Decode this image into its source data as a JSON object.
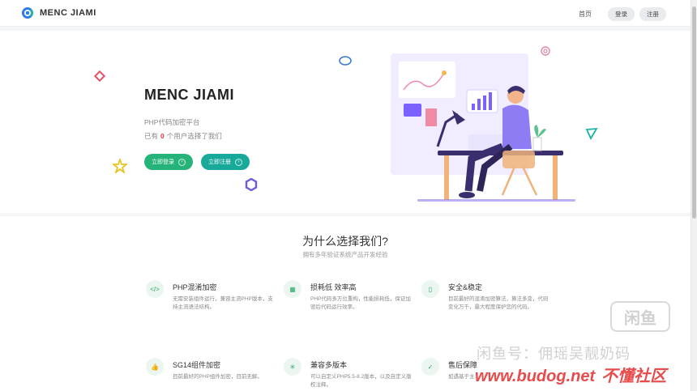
{
  "header": {
    "brand": "MENC JIAMI",
    "nav": {
      "home": "首页",
      "login": "登录",
      "register": "注册"
    }
  },
  "hero": {
    "title": "MENC JIAMI",
    "subtitle": "PHP代码加密平台",
    "count_prefix": "已有",
    "count_value": "0",
    "count_suffix": "个用户选择了我们",
    "login_button": "立即登录",
    "register_button": "立即注册"
  },
  "features_section": {
    "title": "为什么选择我们?",
    "subtitle": "拥有多年验证系统产品开发经验",
    "items": [
      {
        "icon": "code-icon",
        "title": "PHP混淆加密",
        "desc": "无需安装组件运行，兼容主流PHP版本，支持主流语法结构。"
      },
      {
        "icon": "cpu-icon",
        "title": "损耗低 效率高",
        "desc": "PHP代码多方位重构，性能损耗低，保证加密后代码运行效率。"
      },
      {
        "icon": "phone-icon",
        "title": "安全&稳定",
        "desc": "目前最好的混淆加密算法，算法多变，代码变化万千，最大程度保护您的代码。"
      },
      {
        "icon": "thumbs-up-icon",
        "title": "SG14组件加密",
        "desc": "目前最好的PHP组件加密，目前无解。"
      },
      {
        "icon": "asterisk-icon",
        "title": "兼容多版本",
        "desc": "可以自定义PHP5.5-8.2版本，以及自定义版权注释。"
      },
      {
        "icon": "shield-check-icon",
        "title": "售后保障",
        "desc": "如遇基于主..."
      }
    ]
  },
  "watermark": {
    "badge": "闲鱼",
    "line1": "闲鱼号：佣瑶吴靓奶码",
    "url": "www.budog.net",
    "site": "不懂社区"
  },
  "colors": {
    "primary_green": "#26b379",
    "teal": "#17a99a",
    "accent_red": "#e53935",
    "illustration_purple": "#7b61ff"
  }
}
